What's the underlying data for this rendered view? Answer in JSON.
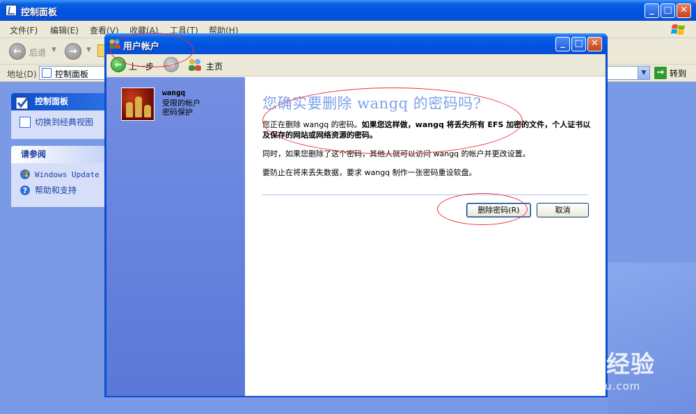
{
  "control_panel": {
    "title": "控制面板",
    "menu": [
      "文件(F)",
      "编辑(E)",
      "查看(V)",
      "收藏(A)",
      "工具(T)",
      "帮助(H)"
    ],
    "back_label": "后退",
    "address_label": "地址(D)",
    "address_value": "控制面板",
    "go_label": "转到",
    "panel_title": "控制面板",
    "switch_view": "切换到经典视图",
    "see_also_title": "请参阅",
    "windows_update": "Windows Update",
    "help_support": "帮助和支持"
  },
  "user_accounts": {
    "title": "用户帐户",
    "back_label": "上一步",
    "home_label": "主页",
    "user": {
      "name": "wangq",
      "type": "受限的帐户",
      "status": "密码保护"
    },
    "question": "您确实要删除 wangq 的密码吗?",
    "p1_normal": "您正在删除 wangq 的密码。",
    "p1_bold": "如果您这样做，wangq 将丢失所有 EFS 加密的文件，个人证书以及保存的网站或网络资源的密码。",
    "p2": "同时，如果您删除了这个密码，其他人就可以访问 wangq 的帐户并更改设置。",
    "p3": "要防止在将来丢失数据，要求 wangq 制作一张密码重设软盘。",
    "delete_button": "删除密码(R)",
    "cancel_button": "取消"
  },
  "watermark": {
    "brand": "Baidu经验",
    "url": "jingyan.baidu.com"
  },
  "colors": {
    "title_blue": "#0053e1",
    "annotation_red": "#e8303a",
    "question_blue": "#7da2e9"
  }
}
